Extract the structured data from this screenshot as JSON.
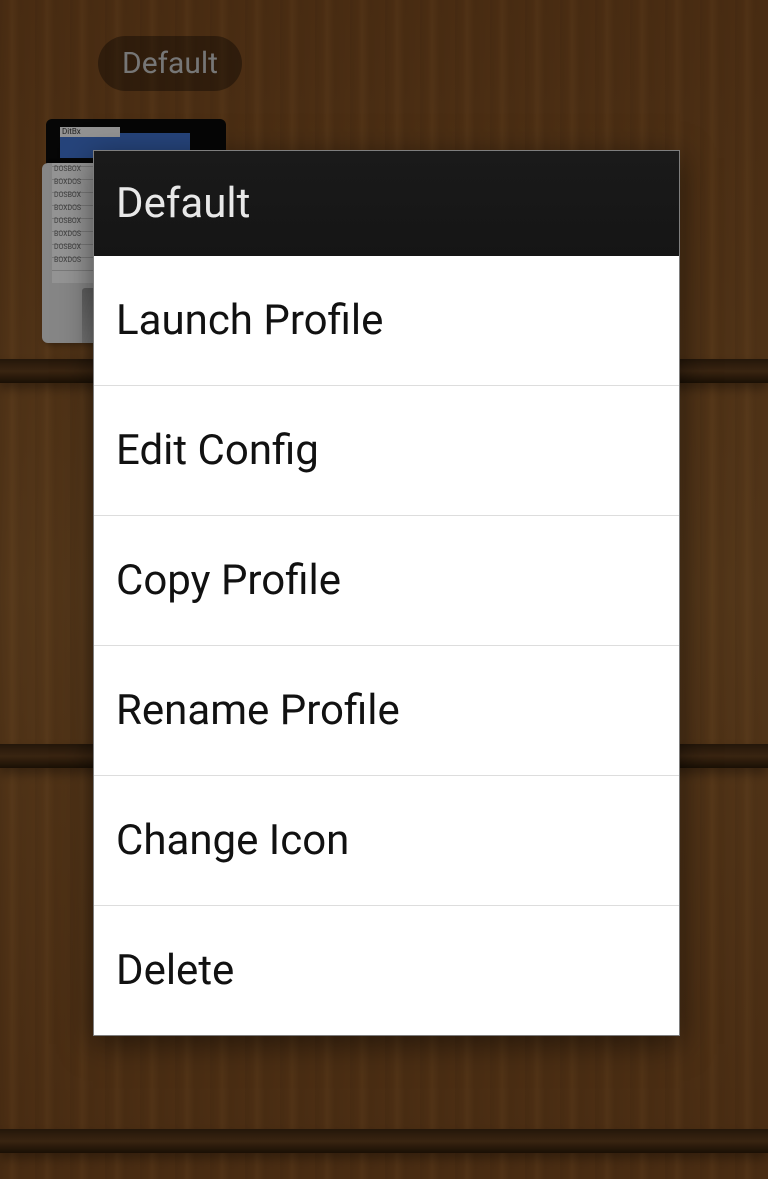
{
  "profile": {
    "chip_label": "Default"
  },
  "dialog": {
    "title": "Default",
    "items": [
      "Launch Profile",
      "Edit Config",
      "Copy Profile",
      "Rename Profile",
      "Change Icon",
      "Delete"
    ]
  }
}
